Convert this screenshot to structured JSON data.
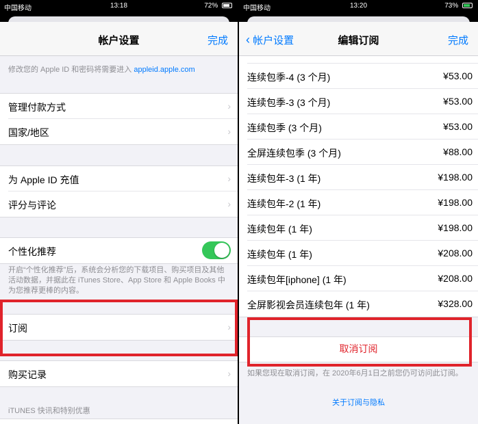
{
  "left": {
    "status": {
      "carrier": "中国移动",
      "time": "13:18",
      "battery": "72%"
    },
    "nav": {
      "title": "帐户设置",
      "done": "完成"
    },
    "apple_id_caption_prefix": "修改您的 Apple ID 和密码将需要进入 ",
    "apple_id_caption_link": "appleid.apple.com",
    "rows_payment": [
      "管理付款方式",
      "国家/地区"
    ],
    "rows_balance": [
      "为 Apple ID 充值",
      "评分与评论"
    ],
    "personalized_label": "个性化推荐",
    "personalized_caption": "开启“个性化推荐”后，系统会分析您的下载项目、购买项目及其他活动数据，并据此在 iTunes Store、App Store 和 Apple Books 中为您推荐更棒的内容。",
    "subscriptions_label": "订阅",
    "purchase_history_label": "购买记录",
    "itunes_section": "iTUNES 快讯和特别优惠"
  },
  "right": {
    "status": {
      "carrier": "中国移动",
      "time": "13:20",
      "battery": "73%"
    },
    "nav": {
      "back": "帐户设置",
      "title": "编辑订阅",
      "done": "完成"
    },
    "plans": [
      {
        "name": "连续包季-4 (3 个月)",
        "price": "¥53.00"
      },
      {
        "name": "连续包季-3 (3 个月)",
        "price": "¥53.00"
      },
      {
        "name": "连续包季 (3 个月)",
        "price": "¥53.00"
      },
      {
        "name": "全屏连续包季 (3 个月)",
        "price": "¥88.00"
      },
      {
        "name": "连续包年-3 (1 年)",
        "price": "¥198.00"
      },
      {
        "name": "连续包年-2 (1 年)",
        "price": "¥198.00"
      },
      {
        "name": "连续包年 (1 年)",
        "price": "¥198.00"
      },
      {
        "name": "连续包年 (1 年)",
        "price": "¥208.00"
      },
      {
        "name": "连续包年[iphone] (1 年)",
        "price": "¥208.00"
      },
      {
        "name": "全屏影视会员连续包年 (1 年)",
        "price": "¥328.00"
      }
    ],
    "cancel_label": "取消订阅",
    "cancel_caption": "如果您现在取消订阅，在 2020年6月1日之前您仍可访问此订阅。",
    "privacy_link": "关于订阅与隐私"
  },
  "colors": {
    "accent": "#007aff",
    "highlight": "#e0232b",
    "toggle_on": "#34c759"
  }
}
